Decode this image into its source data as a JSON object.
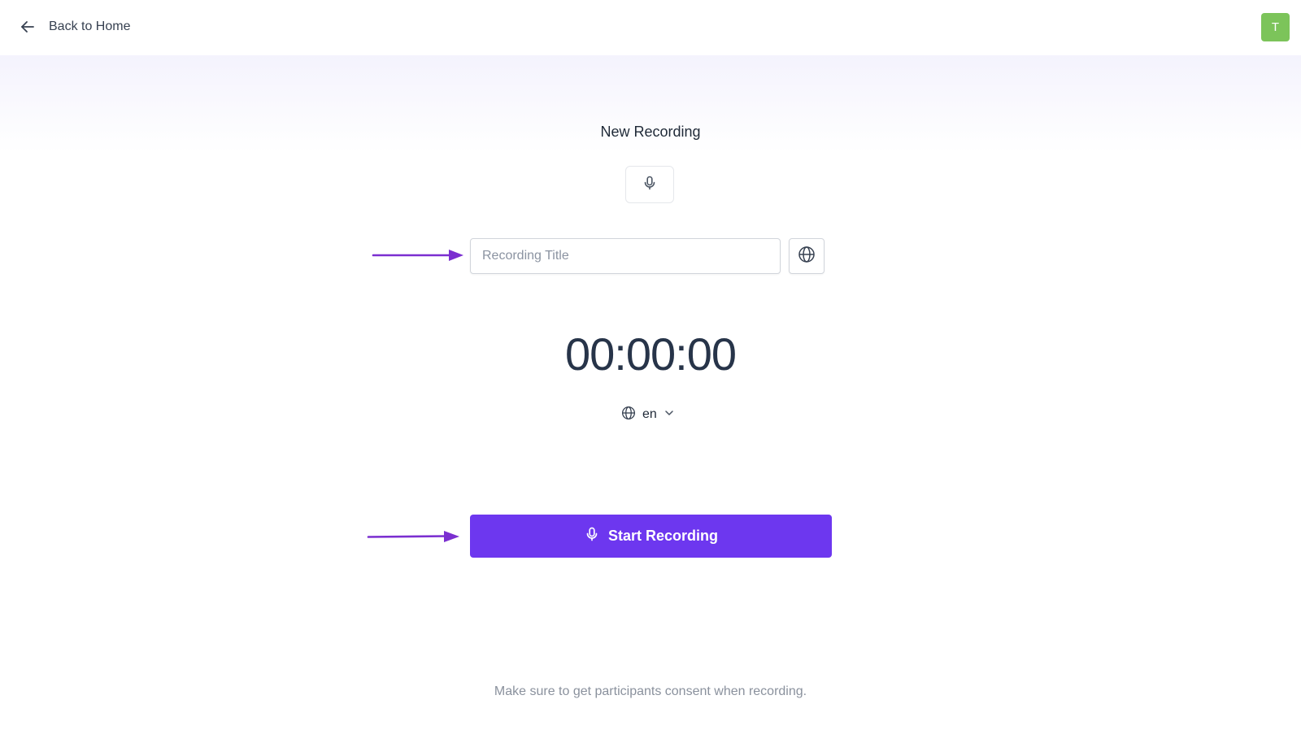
{
  "header": {
    "back_label": "Back to Home",
    "back_icon": "arrow-left-icon",
    "avatar_initial": "T",
    "avatar_color": "#7cc45a"
  },
  "main": {
    "title": "New Recording",
    "mic_icon": "microphone-icon",
    "title_input": {
      "placeholder": "Recording Title",
      "value": ""
    },
    "language_button_icon": "globe-icon",
    "timer": "00:00:00",
    "language_select": {
      "icon": "globe-icon",
      "value": "en"
    },
    "start_button": {
      "label": "Start Recording",
      "icon": "microphone-icon",
      "color": "#6d37ef"
    },
    "consent_note": "Make sure to get participants consent when recording."
  },
  "annotations": {
    "arrow_color": "#7b2fd0"
  }
}
